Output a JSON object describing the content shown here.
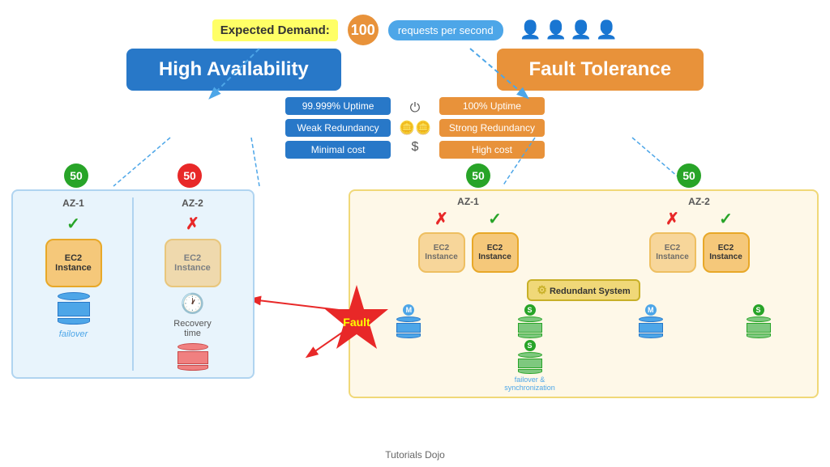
{
  "top": {
    "expected_demand_label": "Expected Demand:",
    "demand_number": "100",
    "demand_text": "requests per second"
  },
  "headers": {
    "ha_title": "High Availability",
    "ft_title": "Fault Tolerance"
  },
  "comparison": {
    "ha": [
      {
        "label": "99.999% Uptime"
      },
      {
        "label": "Weak Redundancy"
      },
      {
        "label": "Minimal cost"
      }
    ],
    "icons": [
      "⏻",
      "⬤⬤",
      "$"
    ],
    "ft": [
      {
        "label": "100% Uptime"
      },
      {
        "label": "Strong Redundancy"
      },
      {
        "label": "High cost"
      }
    ]
  },
  "ha_panel": {
    "az1_label": "AZ-1",
    "az2_label": "AZ-2",
    "ec2_label": "EC2\nInstance",
    "failover_label": "failover",
    "recovery_label": "Recovery\ntime",
    "num_az1": "50",
    "num_az2": "50"
  },
  "ft_panel": {
    "az1_label": "AZ-1",
    "az2_label": "AZ-2",
    "redundant_system": "Redundant System",
    "failover_sync": "failover &\nsynchronization",
    "num_az1": "50",
    "num_az2": "50"
  },
  "fault": {
    "label": "Fault"
  },
  "footer": {
    "label": "Tutorials Dojo"
  }
}
